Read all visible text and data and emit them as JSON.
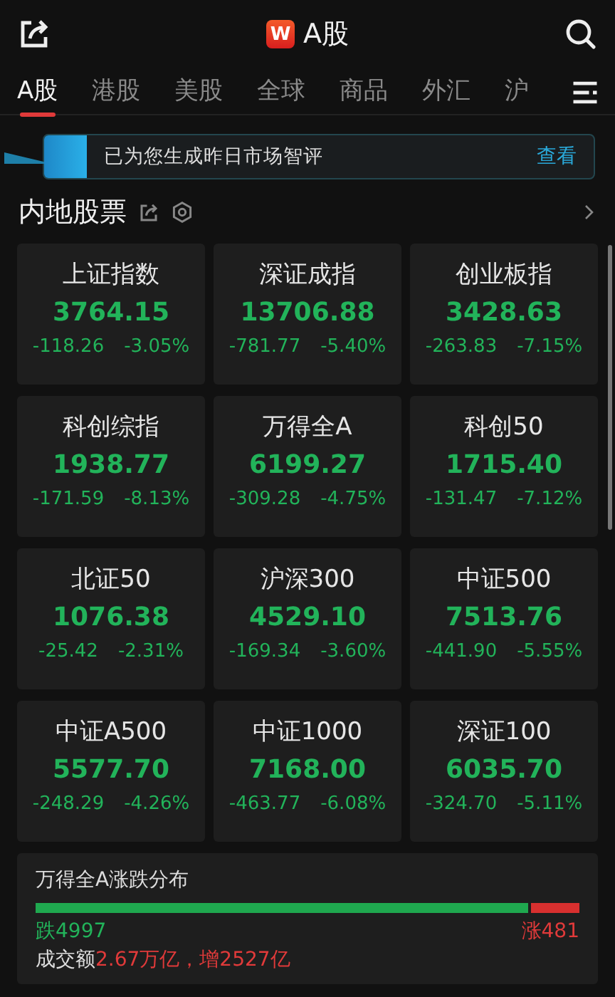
{
  "header": {
    "logo": "W",
    "title": "A股"
  },
  "tabs": [
    {
      "label": "A股",
      "selected": true
    },
    {
      "label": "港股",
      "selected": false
    },
    {
      "label": "美股",
      "selected": false
    },
    {
      "label": "全球",
      "selected": false
    },
    {
      "label": "商品",
      "selected": false
    },
    {
      "label": "外汇",
      "selected": false
    },
    {
      "label": "沪",
      "selected": false
    }
  ],
  "banner": {
    "text": "已为您生成昨日市场智评",
    "action": "查看"
  },
  "section": {
    "title": "内地股票"
  },
  "indices": [
    {
      "name": "上证指数",
      "value": "3764.15",
      "change": "-118.26",
      "percent": "-3.05%",
      "color": "#22b35a"
    },
    {
      "name": "深证成指",
      "value": "13706.88",
      "change": "-781.77",
      "percent": "-5.40%",
      "color": "#22b35a"
    },
    {
      "name": "创业板指",
      "value": "3428.63",
      "change": "-263.83",
      "percent": "-7.15%",
      "color": "#22b35a"
    },
    {
      "name": "科创综指",
      "value": "1938.77",
      "change": "-171.59",
      "percent": "-8.13%",
      "color": "#22b35a"
    },
    {
      "name": "万得全A",
      "value": "6199.27",
      "change": "-309.28",
      "percent": "-4.75%",
      "color": "#22b35a"
    },
    {
      "name": "科创50",
      "value": "1715.40",
      "change": "-131.47",
      "percent": "-7.12%",
      "color": "#22b35a"
    },
    {
      "name": "北证50",
      "value": "1076.38",
      "change": "-25.42",
      "percent": "-2.31%",
      "color": "#22b35a"
    },
    {
      "name": "沪深300",
      "value": "4529.10",
      "change": "-169.34",
      "percent": "-3.60%",
      "color": "#22b35a"
    },
    {
      "name": "中证500",
      "value": "7513.76",
      "change": "-441.90",
      "percent": "-5.55%",
      "color": "#22b35a"
    },
    {
      "name": "中证A500",
      "value": "5577.70",
      "change": "-248.29",
      "percent": "-4.26%",
      "color": "#22b35a"
    },
    {
      "name": "中证1000",
      "value": "7168.00",
      "change": "-463.77",
      "percent": "-6.08%",
      "color": "#22b35a"
    },
    {
      "name": "深证100",
      "value": "6035.70",
      "change": "-324.70",
      "percent": "-5.11%",
      "color": "#22b35a"
    }
  ],
  "distribution": {
    "title": "万得全A涨跌分布",
    "level": 0.912,
    "down_label": "跌4997",
    "up_label": "涨481",
    "turnover_label": "成交额",
    "turnover_value": "2.67万亿，增2527亿"
  }
}
